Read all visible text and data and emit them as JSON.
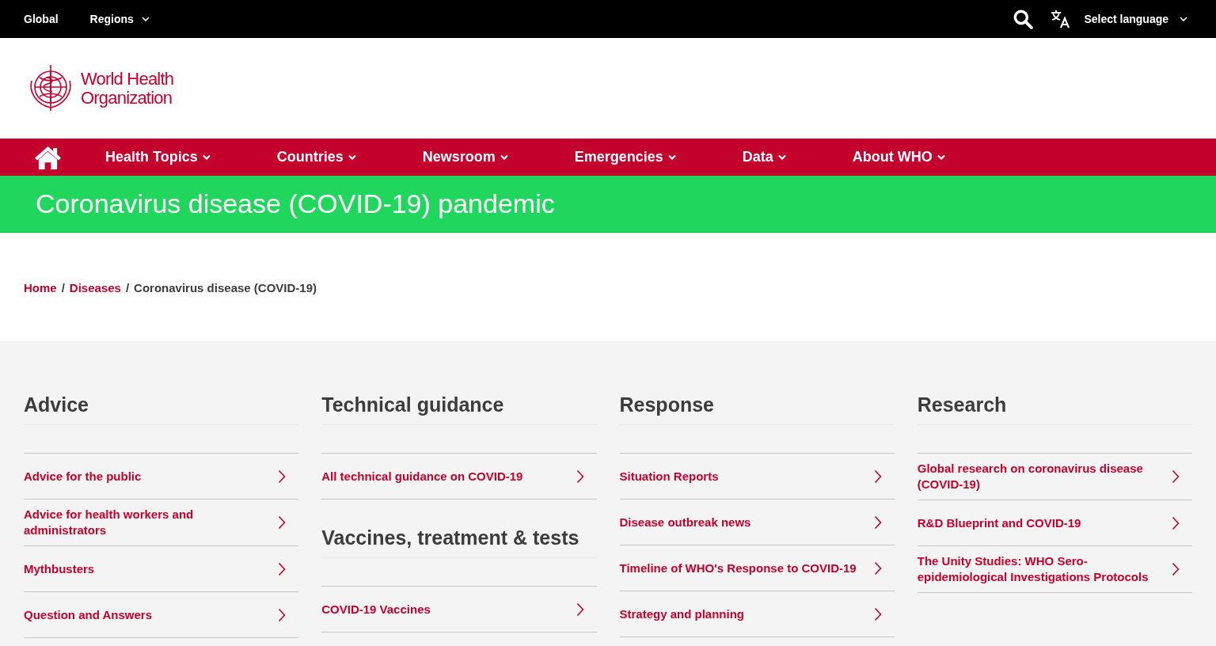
{
  "top_bar": {
    "links": [
      {
        "label": "Global",
        "has_dropdown": false
      },
      {
        "label": "Regions",
        "has_dropdown": true
      }
    ],
    "language": "Select language"
  },
  "logo": {
    "line_1": "World Health",
    "line_2": "Organization"
  },
  "nav": [
    "Health Topics",
    "Countries",
    "Newsroom",
    "Emergencies",
    "Data",
    "About WHO"
  ],
  "banner": {
    "title": "Coronavirus disease (COVID-19) pandemic"
  },
  "breadcrumb": [
    {
      "label": "Home",
      "link": true
    },
    {
      "separator": "/",
      "label": "Diseases",
      "link": true
    },
    {
      "separator": "/",
      "label": "Coronavirus disease (COVID-19)",
      "link": false
    }
  ],
  "columns": [
    {
      "sections": [
        {
          "heading": "Advice",
          "links": [
            "Advice for the public",
            "Advice for health workers and administrators",
            "Mythbusters",
            "Question and Answers"
          ]
        }
      ]
    },
    {
      "sections": [
        {
          "heading": "Technical guidance",
          "links": [
            "All technical guidance on COVID-19"
          ]
        },
        {
          "heading": "Vaccines, treatment & tests",
          "links": [
            "COVID-19 Vaccines"
          ]
        }
      ]
    },
    {
      "sections": [
        {
          "heading": "Response",
          "links": [
            "Situation Reports",
            "Disease outbreak news",
            "Timeline of WHO's Response to COVID-19",
            "Strategy and planning"
          ]
        }
      ]
    },
    {
      "sections": [
        {
          "heading": "Research",
          "links": [
            "Global research on coronavirus disease (COVID-19)",
            "R&D Blueprint and COVID-19",
            "The Unity Studies: WHO Sero-epidemiological Investigations Protocols"
          ]
        }
      ]
    }
  ]
}
